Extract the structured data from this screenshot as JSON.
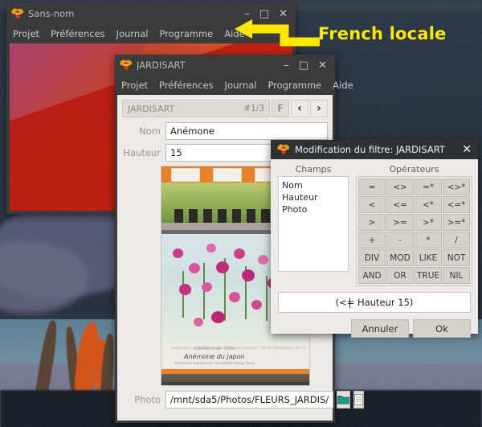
{
  "annotation": {
    "text": "French locale",
    "color": "#ffe800",
    "arrow_icon": "elbow-arrow-left-icon"
  },
  "main_window": {
    "title": "Sans-nom",
    "icon": "bee-icon",
    "controls": {
      "minimize": "–",
      "maximize": "□",
      "close": "✕"
    },
    "menu": [
      "Projet",
      "Préférences",
      "Journal",
      "Programme",
      "Aide"
    ],
    "logo_icon": "hexagon-bee-logo"
  },
  "record_window": {
    "title": "JARDISART",
    "icon": "bee-icon",
    "controls": {
      "minimize": "–",
      "maximize": "□",
      "close": "✕"
    },
    "menu": [
      "Projet",
      "Préférences",
      "Journal",
      "Programme",
      "Aide"
    ],
    "nav": {
      "table_name": "JARDISART",
      "record_index": "#1/3",
      "filter_button": "F",
      "prev_button": "‹",
      "next_button": "›"
    },
    "fields": [
      {
        "label": "Nom",
        "value": "Anémone"
      },
      {
        "label": "Hauteur",
        "value": "15"
      }
    ],
    "photo_field": {
      "label": "Photo",
      "value": "/mnt/sda5/Photos/FLEURS_JARDIS/",
      "browse_icon": "folder-icon",
      "document_icon": "document-icon"
    },
    "photo_caption": {
      "line1": "Couleurs de l'été",
      "line2": "Anémone du Japon",
      "line3": "Anemone hupehensis 'Annabelle Deep Rose'",
      "right": "Exposition : soleil  Floraison : mi-saison  Hauteur : 50 cm  Plantation : m² : 3"
    }
  },
  "filter_dialog": {
    "title": "Modification du filtre: JARDISART",
    "icon": "bee-icon",
    "close_icon": "✕",
    "fields_label": "Champs",
    "fields": [
      "Nom",
      "Hauteur",
      "Photo"
    ],
    "operators_label": "Opérateurs",
    "operators": [
      "=",
      "<>",
      "=*",
      "<>*",
      "<",
      "<=",
      "<*",
      "<=*",
      ">",
      ">=",
      ">*",
      ">=*",
      "+",
      "-",
      "*",
      "/",
      "DIV",
      "MOD",
      "LIKE",
      "NOT",
      "AND",
      "OR",
      "TRUE",
      "NIL"
    ],
    "expression": "(<= Hauteur 15)",
    "cancel_button": "Annuler",
    "ok_button": "Ok"
  }
}
